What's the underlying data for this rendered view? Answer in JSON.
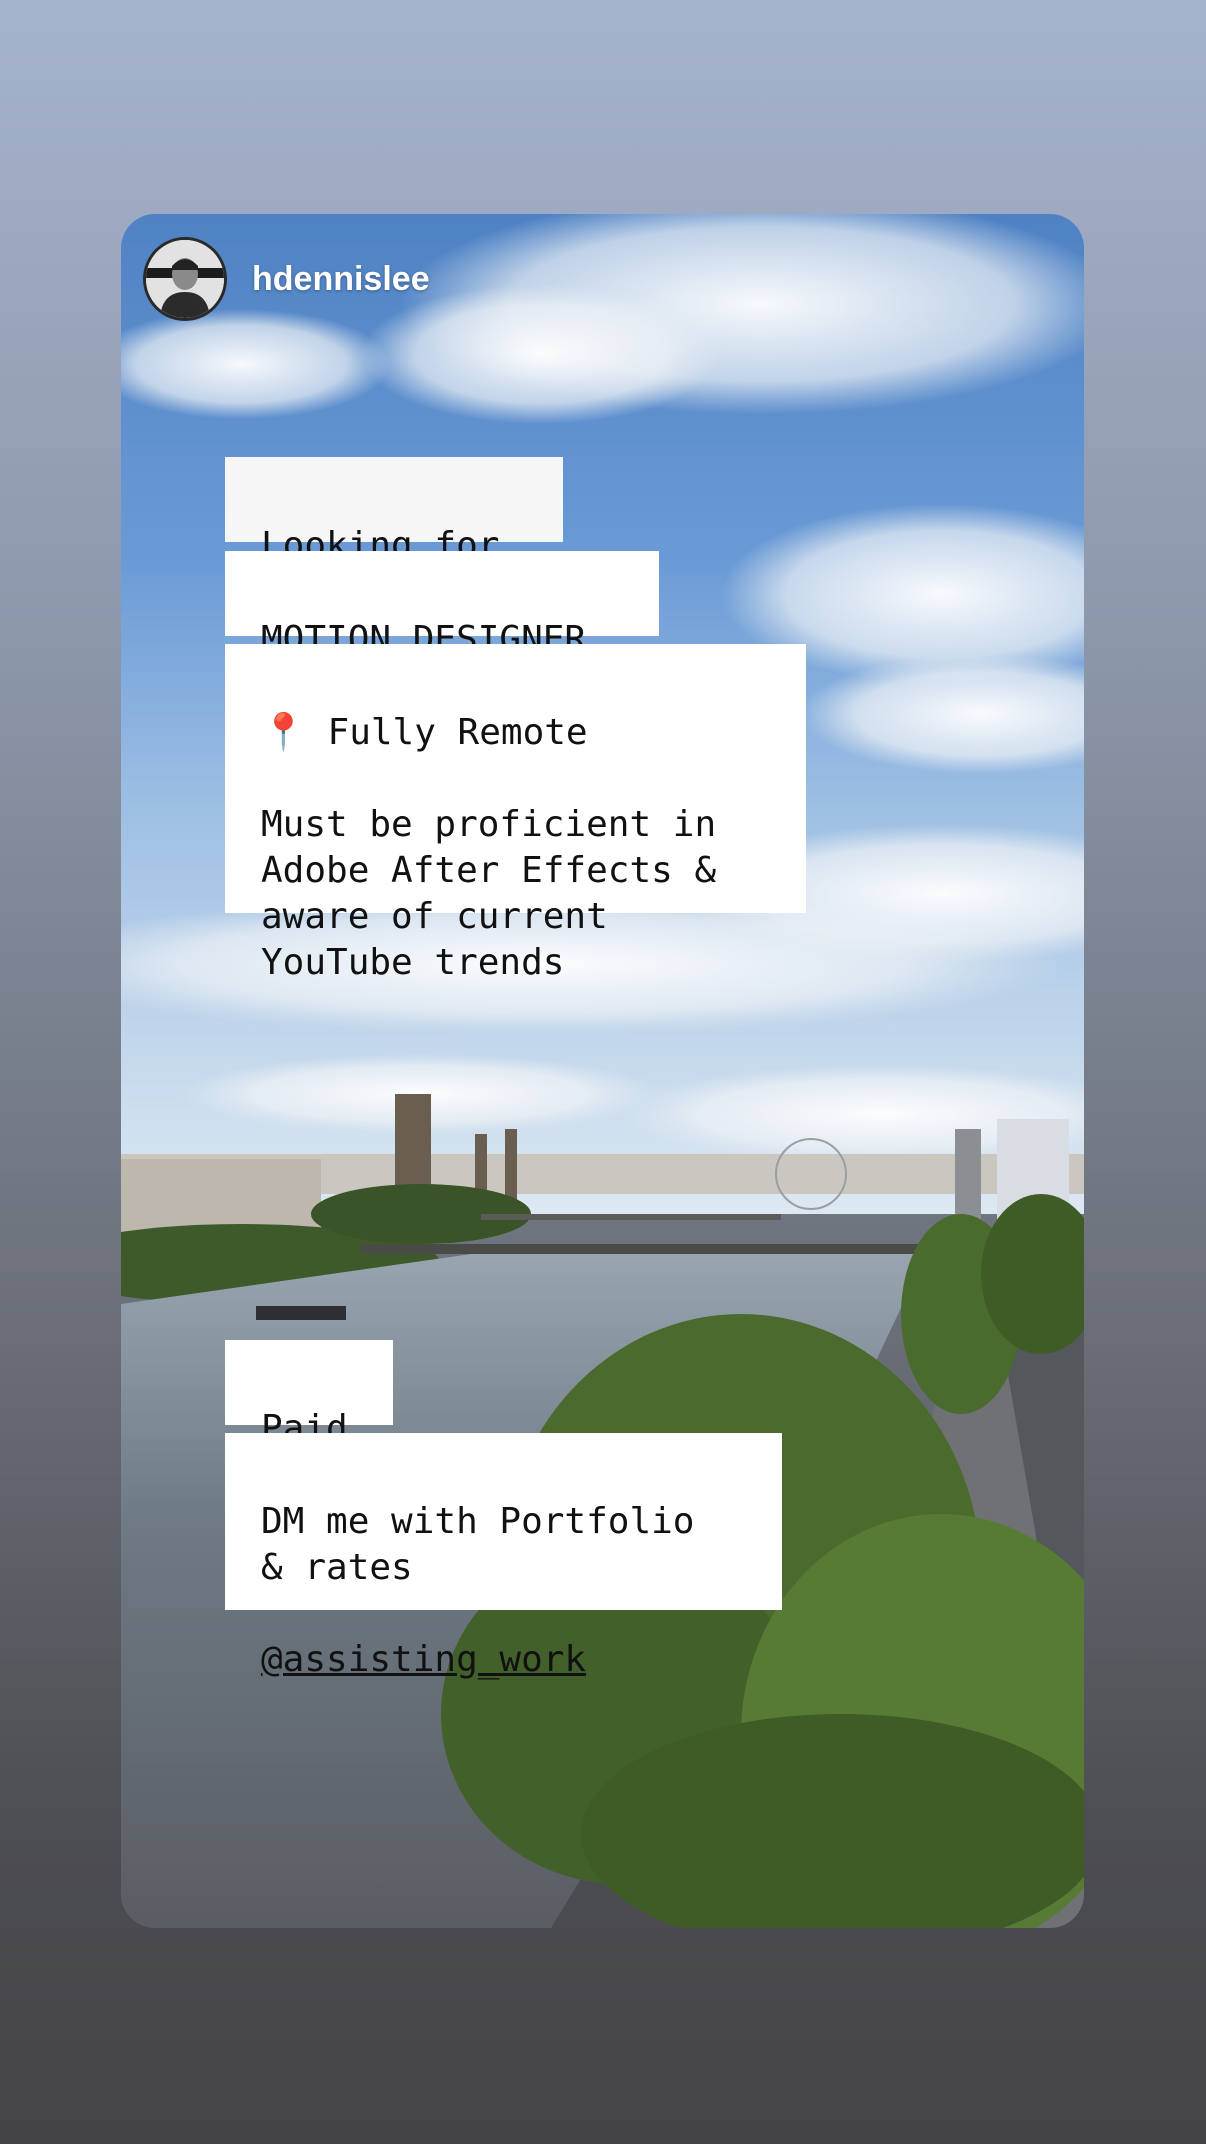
{
  "story": {
    "username": "hdennislee",
    "stickers": {
      "looking_for": "Looking for",
      "role": "MOTION DESIGNER",
      "location_emoji": "📍",
      "location": "Fully Remote",
      "requirements": "Must be proficient in\nAdobe After Effects &\naware of current\nYouTube trends",
      "pay": "Paid",
      "contact": "DM me with Portfolio\n& rates",
      "mention": "@assisting_work"
    }
  },
  "colors": {
    "background_top": "#a6b3cd",
    "background_bottom": "#444446",
    "sticker_bg": "#ffffff",
    "sticker_text": "#111111"
  }
}
